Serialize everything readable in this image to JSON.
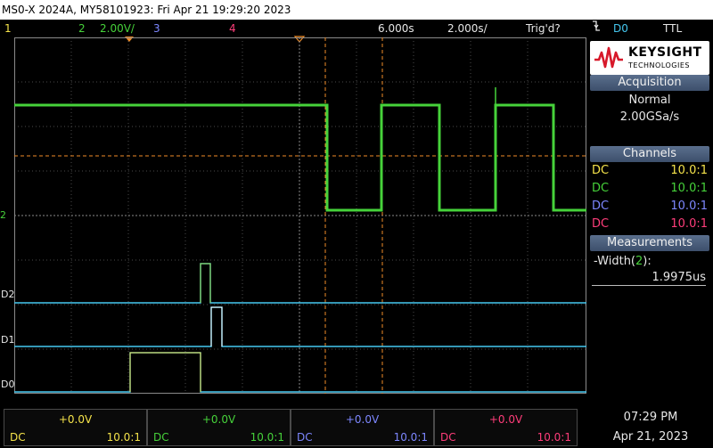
{
  "title_bar": {
    "text": "MS0-X 2024A, MY58101923: Fri Apr 21 19:29:20 2023"
  },
  "channel_bar": {
    "ch1_num": "1",
    "ch2_num": "2",
    "ch2_scale": "2.00V/",
    "ch3_num": "3",
    "ch4_num": "4",
    "timebase_delay": "6.000s",
    "timebase_scale": "2.000s/",
    "trigger_status": "Trig'd?",
    "trigger_icon": "falling-edge-trigger-icon",
    "trigger_source": "D0",
    "trigger_level": "TTL"
  },
  "waveform": {
    "ground_marker": "2",
    "digital_labels": [
      "D2",
      "D1",
      "D0"
    ]
  },
  "brand": {
    "name": "KEYSIGHT",
    "sub": "TECHNOLOGIES"
  },
  "acquisition": {
    "header": "Acquisition",
    "mode": "Normal",
    "sample_rate": "2.00GSa/s"
  },
  "channels": {
    "header": "Channels",
    "rows": [
      {
        "coupling": "DC",
        "probe": "10.0:1"
      },
      {
        "coupling": "DC",
        "probe": "10.0:1"
      },
      {
        "coupling": "DC",
        "probe": "10.0:1"
      },
      {
        "coupling": "DC",
        "probe": "10.0:1"
      }
    ]
  },
  "measurements": {
    "header": "Measurements",
    "label_prefix": "-Width(",
    "label_channel": "2",
    "label_suffix": "):",
    "value": "1.9975us"
  },
  "bottom_bar": {
    "channels": [
      {
        "offset": "+0.0V",
        "coupling": "DC",
        "probe": "10.0:1"
      },
      {
        "offset": "+0.0V",
        "coupling": "DC",
        "probe": "10.0:1"
      },
      {
        "offset": "+0.0V",
        "coupling": "DC",
        "probe": "10.0:1"
      },
      {
        "offset": "+0.0V",
        "coupling": "DC",
        "probe": "10.0:1"
      }
    ],
    "time": "07:29 PM",
    "date": "Apr 21, 2023"
  },
  "colors": {
    "ch1": "#f5e34a",
    "ch2": "#46d23a",
    "ch3": "#7d87ff",
    "ch4": "#ff3d7a",
    "digital": "#45c8f0",
    "cursor": "#f08c28",
    "grid": "#6a6a6a"
  }
}
